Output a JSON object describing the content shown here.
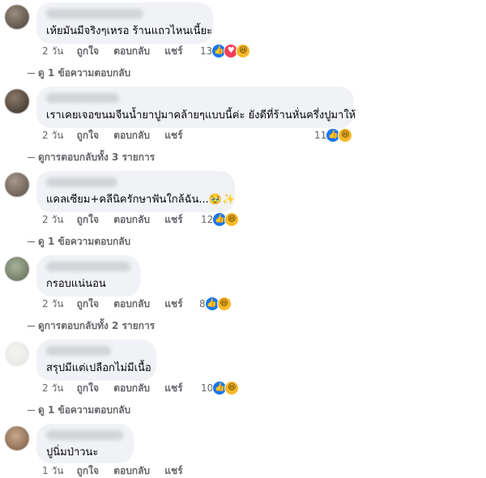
{
  "actions": {
    "like": "ถูกใจ",
    "reply": "ตอบกลับ",
    "share": "แชร์"
  },
  "colors": {
    "bubble": "#f0f2f5",
    "meta_text": "#65676b",
    "like": "#1877f2",
    "love": "#f33e58",
    "haha": "#f7b928"
  },
  "comments": [
    {
      "text": "เห้ยมันมีจริงๆเหรอ ร้านแถวไหนเนี้ยะ",
      "time": "2 วัน",
      "reaction_count": "13",
      "reactions": [
        "like-icon",
        "love-icon",
        "haha-icon"
      ],
      "replies": "ดู 1 ข้อความตอบกลับ"
    },
    {
      "text": "เราเคยเจอขนมจีนน้ำยาปูมาคล้ายๆแบบนี้ค่ะ ยังดีที่ร้านหั่นครึ่งปูมาให้",
      "time": "2 วัน",
      "reaction_count": "11",
      "reactions": [
        "like-icon",
        "haha-icon"
      ],
      "replies": "ดูการตอบกลับทั้ง 3 รายการ"
    },
    {
      "text": "แคลเซียม+คลีนิครักษาฟันใกล้ฉัน...🥹✨",
      "time": "2 วัน",
      "reaction_count": "12",
      "reactions": [
        "like-icon",
        "haha-icon"
      ],
      "replies": "ดู 1 ข้อความตอบกลับ"
    },
    {
      "text": "กรอบแน่นอน",
      "time": "2 วัน",
      "reaction_count": "8",
      "reactions": [
        "like-icon",
        "haha-icon"
      ],
      "replies": "ดูการตอบกลับทั้ง 2 รายการ"
    },
    {
      "text": "สรุปมีแต่เปลือกไม่มีเนื้อ",
      "time": "2 วัน",
      "reaction_count": "10",
      "reactions": [
        "like-icon",
        "haha-icon"
      ],
      "replies": "ดู 1 ข้อความตอบกลับ"
    },
    {
      "text": "ปูนิ่มป่าวนะ",
      "time": "1 วัน",
      "reaction_count": "",
      "reactions": [],
      "replies": ""
    }
  ]
}
